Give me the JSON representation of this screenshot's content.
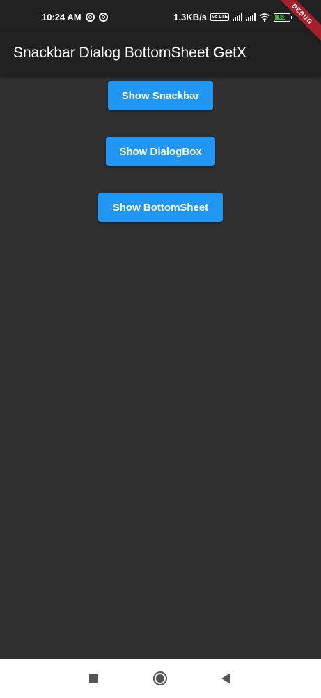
{
  "status_bar": {
    "time": "10:24 AM",
    "network_speed": "1.3KB/s",
    "volte": "Vo LTE",
    "battery_level": "63",
    "icons": [
      "sync-icon",
      "sync-icon",
      "volte-icon",
      "signal-icon",
      "signal-icon",
      "wifi-icon",
      "battery-icon"
    ]
  },
  "debug_banner": "DEBUG",
  "app_bar": {
    "title": "Snackbar Dialog BottomSheet GetX"
  },
  "buttons": {
    "snackbar": "Show Snackbar",
    "dialog": "Show DialogBox",
    "bottomsheet": "Show BottomSheet"
  },
  "nav_bar": {
    "icons": [
      "recent-apps-icon",
      "home-icon",
      "back-icon"
    ]
  },
  "colors": {
    "background": "#303030",
    "app_bar": "#212121",
    "button": "#2196f3",
    "debug_ribbon": "#a4212a",
    "nav_bar": "#ffffff"
  }
}
